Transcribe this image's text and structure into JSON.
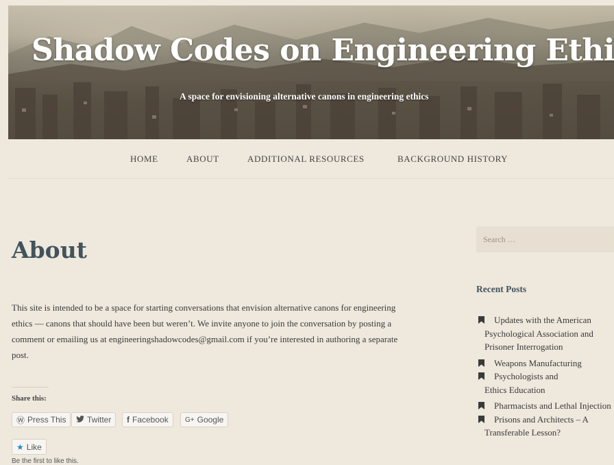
{
  "header": {
    "site_title": "Shadow Codes on Engineering Ethics",
    "tagline": "A space for envisioning alternative canons in engineering ethics"
  },
  "nav": {
    "items": [
      {
        "label": "HOME"
      },
      {
        "label": "ABOUT"
      },
      {
        "label": "ADDITIONAL RESOURCES"
      },
      {
        "label": "BACKGROUND HISTORY"
      }
    ]
  },
  "main": {
    "title": "About",
    "body": "This site is intended to be a space for starting conversations that envision alternative canons for engineering ethics — canons that should have been but weren’t. We invite anyone to join the conversation by posting a comment or emailing us at engineeringshadowcodes@gmail.com if you’re interested in authoring a separate post.",
    "share_title": "Share this:",
    "share_buttons": [
      {
        "label": "Press This",
        "icon": "wordpress-icon"
      },
      {
        "label": "Twitter",
        "icon": "twitter-icon"
      },
      {
        "label": "Facebook",
        "icon": "facebook-icon"
      },
      {
        "label": "Google",
        "icon": "google-plus-icon"
      }
    ],
    "like_label": "Like",
    "like_note": "Be the first to like this."
  },
  "sidebar": {
    "search_placeholder": "Search …",
    "recent_posts_title": "Recent Posts",
    "recent_posts": [
      {
        "lines": [
          "Updates with the American",
          "Psychological Association and",
          "Prisoner Interrogation"
        ]
      },
      {
        "lines": [
          "Weapons Manufacturing"
        ]
      },
      {
        "lines": [
          "Psychologists and",
          "Ethics Education"
        ]
      },
      {
        "lines": [
          "Pharmacists and Lethal Injection"
        ]
      },
      {
        "lines": [
          "Prisons and Architects – A",
          "Transferable Lesson?"
        ]
      }
    ]
  },
  "colors": {
    "background": "#eee8dd",
    "heading": "#42535c",
    "like_star": "#2b85c2"
  }
}
